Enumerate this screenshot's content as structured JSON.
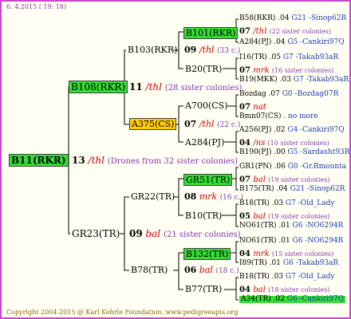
{
  "header": {
    "date": "6.  4.2015  ( 19: 18)"
  },
  "footer": {
    "copyright": "Copyright 2004-2015 @ Karl Kehrle Foundation.   www.pedigreeapis.org"
  },
  "tree": {
    "root": {
      "name": "B11(RKR)",
      "year": "13",
      "breed": "/thl",
      "info": "(Drones from 32 sister colonies)"
    },
    "dam": {
      "name": "B108(RKR)",
      "year": "11",
      "breed": "/thl",
      "info": "(28 sister colonies)"
    },
    "sire": {
      "name": "GR23(TR)",
      "year": "09",
      "breed": "bal",
      "info": "(21 sister colonies)"
    },
    "g3": [
      {
        "name": "B103(RKR)",
        "year": "09",
        "breed": "/thl",
        "info": "(33 c.)"
      },
      {
        "name": "A375(CS)",
        "year": "07",
        "breed": "/thl",
        "info": "(22 c.)"
      },
      {
        "name": "GR22(TR)",
        "year": "08",
        "breed": "mrk",
        "info": "(16 c.)"
      },
      {
        "name": "B78(TR)",
        "year": "06",
        "breed": "bal",
        "info": "(18 c.)"
      }
    ],
    "g4": [
      "B101(RKR)",
      "B20(TR)",
      "A700(CS)",
      "A284(PJ)",
      "GR51(TR)",
      "B10(TR)",
      "B132(TR)",
      "B77(TR)"
    ]
  },
  "g5": [
    {
      "type": "anc",
      "text": "B58(RKR) .04",
      "tail": "G21 -Sinop62R",
      "box": false
    },
    {
      "type": "mat",
      "year": "07",
      "breed": "/thl",
      "info": "(22 sister colonies)"
    },
    {
      "type": "anc",
      "text": "A284(PJ) .04",
      "tail": "G5 -Cankiri97Q",
      "box": false
    },
    {
      "type": "anc",
      "text": "I16(TR) .05",
      "tail": "G7 -Takab93aR",
      "box": false
    },
    {
      "type": "mat",
      "year": "07",
      "breed": "mrk",
      "info": "(16 sister colonies)"
    },
    {
      "type": "anc",
      "text": "B19(MKK) .03",
      "tail": "G7 -Takab93aR",
      "box": false
    },
    {
      "type": "anc",
      "text": "Bozdag .07",
      "tail": "G0 -Bozdag07R",
      "box": false
    },
    {
      "type": "mat",
      "year": "07",
      "breed": "nat",
      "info": ""
    },
    {
      "type": "anc",
      "text": "Bmn07(CS) .",
      "tail": "no more",
      "box": false
    },
    {
      "type": "anc",
      "text": "A256(PJ) .02",
      "tail": "G4 -Cankiri97Q",
      "box": false
    },
    {
      "type": "mat",
      "year": "04",
      "breed": "/ns",
      "info": "(10 sister colonies)"
    },
    {
      "type": "anc",
      "text": "B190(PJ) .00",
      "tail": "G5 -Sardasht93R",
      "box": false
    },
    {
      "type": "anc",
      "text": "GR1(PN) .06",
      "tail": "G0 -Gr.Rmounta",
      "box": false
    },
    {
      "type": "mat",
      "year": "07",
      "breed": "bal",
      "info": "(19 sister colonies)"
    },
    {
      "type": "anc",
      "text": "B175(TR) .04",
      "tail": "G21 -Sinop62R",
      "box": false
    },
    {
      "type": "anc",
      "text": "B18(TR) .03",
      "tail": "G7 -Old_Lady",
      "box": false
    },
    {
      "type": "mat",
      "year": "05",
      "breed": "bal",
      "info": "(19 sister colonies)"
    },
    {
      "type": "anc",
      "text": "NO61(TR) .01",
      "tail": "G6 -NO6294R",
      "box": false
    },
    {
      "type": "anc",
      "text": "NO61(TR) .01",
      "tail": "G6 -NO6294R",
      "box": false
    },
    {
      "type": "mat",
      "year": "04",
      "breed": "mrk",
      "info": "(15 sister colonies)"
    },
    {
      "type": "anc",
      "text": "I89(TR) .01",
      "tail": "G6 -Takab93aR",
      "box": false
    },
    {
      "type": "anc",
      "text": "B18(TR) .03",
      "tail": "G7 -Old_Lady",
      "box": false
    },
    {
      "type": "mat",
      "year": "04",
      "breed": "bal",
      "info": "(18 sister colonies)"
    },
    {
      "type": "anc",
      "text": "A34(TR) .02",
      "tail": "G6 -Cankiri97Q",
      "box": true
    }
  ],
  "colors": {
    "highlight_green": "#33dd33",
    "highlight_yellow": "#ffcc00",
    "border": "#cc44cc",
    "breed_red": "#cc0000",
    "info_purple": "#8833aa",
    "line_blue": "#1a3bb0"
  }
}
